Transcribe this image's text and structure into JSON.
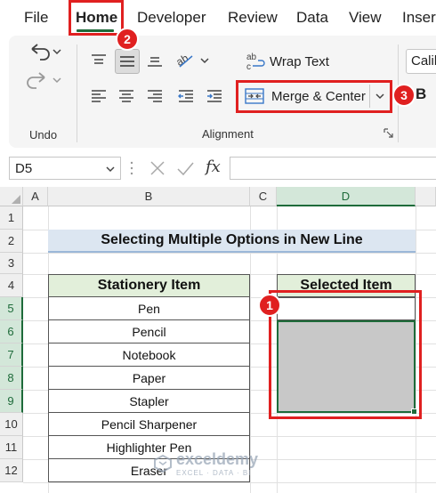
{
  "menu": {
    "tabs": [
      "File",
      "Home",
      "Developer",
      "Review",
      "Data",
      "View",
      "Inser"
    ],
    "active_tab": "Home"
  },
  "ribbon": {
    "undo_label": "Undo",
    "alignment_label": "Alignment",
    "wrap_text": "Wrap Text",
    "merge_center": "Merge & Center",
    "font_name": "Calibr",
    "bold": "B"
  },
  "formula_bar": {
    "name_box": "D5",
    "fx": "fx",
    "formula": ""
  },
  "callouts": [
    "1",
    "2",
    "3"
  ],
  "sheet": {
    "columns": [
      "A",
      "B",
      "C",
      "D"
    ],
    "rows": [
      "1",
      "2",
      "3",
      "4",
      "5",
      "6",
      "7",
      "8",
      "9",
      "10",
      "11",
      "12"
    ],
    "title": "Selecting Multiple Options in New Line",
    "stationery_header": "Stationery Item",
    "items": [
      "Pen",
      "Pencil",
      "Notebook",
      "Paper",
      "Stapler",
      "Pencil Sharpener",
      "Highlighter Pen",
      "Eraser"
    ],
    "selected_header": "Selected Item"
  },
  "watermark": {
    "name": "exceldemy",
    "tagline": "EXCEL · DATA · BI"
  },
  "colors": {
    "accent": "#1e6b3a",
    "callout": "#e02020",
    "title_fill": "#dce6f1",
    "header_fill": "#e2efda",
    "selection_fill": "#c8c8c8"
  }
}
